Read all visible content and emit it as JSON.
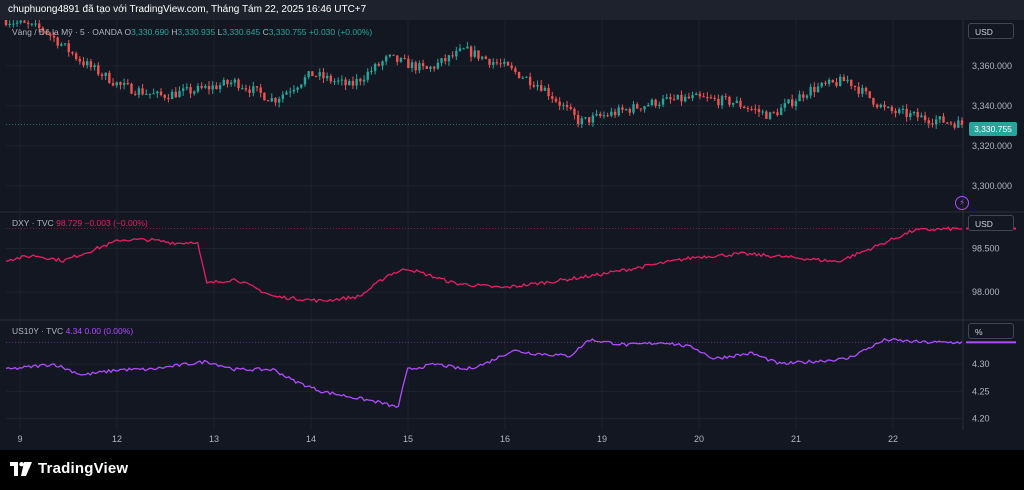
{
  "header": {
    "text": "chuphuong4891 đã tạo với TradingView.com, Tháng Tám 22, 2025 16:46 UTC+7"
  },
  "panes": {
    "gold": {
      "symbol": "Vàng / Đô la Mỹ · 5 · OANDA",
      "o_key": "O",
      "o_val": "3,330.690",
      "h_key": "H",
      "h_val": "3,330.935",
      "l_key": "L",
      "l_val": "3,330.645",
      "c_key": "C",
      "c_val": "3,330.755",
      "change": "+0.030 (+0.00%)",
      "unit": "USD",
      "last_price": "3,330.755"
    },
    "dxy": {
      "symbol": "DXY · TVC",
      "value": "98.729",
      "change": "−0.003 (−0.00%)",
      "unit": "USD"
    },
    "us10y": {
      "symbol": "US10Y · TVC",
      "value": "4.34",
      "change": "0.00 (0.00%)",
      "unit": "%"
    }
  },
  "footer": {
    "brand": "TradingView"
  },
  "colors": {
    "background": "#131722",
    "grid": "#1e222d",
    "up": "#26a69a",
    "down": "#ef5350",
    "dxy_line": "#e91e63",
    "us10y_line": "#b04bff",
    "text": "#b2b5be"
  },
  "icons": {
    "brand_logo": "tradingview-logo-icon",
    "alert": "lightning-icon"
  },
  "chart_data": [
    {
      "type": "candlestick",
      "title": "Vàng / Đô la Mỹ · 5 · OANDA",
      "x_ticks": [
        "9",
        "12",
        "13",
        "14",
        "15",
        "16",
        "19",
        "20",
        "21",
        "22"
      ],
      "y_ticks": [
        "3,300.000",
        "3,320.000",
        "3,340.000",
        "3,360.000"
      ],
      "ylim": [
        3290,
        3380
      ],
      "x": [
        0,
        4,
        8,
        12,
        16,
        20,
        24,
        28,
        32,
        36,
        40,
        44,
        48,
        52,
        56,
        60,
        64,
        68,
        72,
        76,
        80,
        84,
        88,
        92,
        96,
        100
      ],
      "close": [
        3383,
        3378,
        3362,
        3350,
        3345,
        3348,
        3352,
        3343,
        3356,
        3350,
        3364,
        3358,
        3368,
        3360,
        3350,
        3332,
        3337,
        3342,
        3344,
        3342,
        3335,
        3348,
        3353,
        3338,
        3334,
        3331
      ],
      "last": 3330.755,
      "grid": true
    },
    {
      "type": "line",
      "title": "DXY · TVC",
      "series": [
        {
          "name": "DXY · TVC",
          "values": [
            98.37,
            98.42,
            98.36,
            98.48,
            98.6,
            98.6,
            98.56,
            98.58,
            98.1,
            98.15,
            97.95,
            97.9,
            97.95,
            98.2,
            98.27,
            98.1,
            98.05,
            98.12,
            98.2,
            98.3,
            98.4,
            98.44,
            98.4,
            98.35,
            98.48,
            98.71,
            98.73
          ]
        }
      ],
      "x": [
        0,
        3,
        6,
        9,
        12,
        15,
        18,
        20,
        21,
        24,
        28,
        33,
        37,
        40,
        42,
        47,
        52,
        57,
        62,
        67,
        72,
        77,
        82,
        87,
        90,
        95,
        100
      ],
      "y_ticks": [
        "98.000",
        "98.500"
      ],
      "ylim": [
        97.75,
        98.85
      ],
      "last": 98.729,
      "grid": true
    },
    {
      "type": "line",
      "title": "US10Y · TVC",
      "series": [
        {
          "name": "US10Y · TVC",
          "values": [
            4.29,
            4.3,
            4.28,
            4.29,
            4.29,
            4.305,
            4.29,
            4.29,
            4.27,
            4.25,
            4.24,
            4.23,
            4.22,
            4.29,
            4.3,
            4.29,
            4.3,
            4.325,
            4.32,
            4.315,
            4.345,
            4.335,
            4.34,
            4.33,
            4.31,
            4.32,
            4.3,
            4.31,
            4.345,
            4.34,
            4.34
          ]
        }
      ],
      "x": [
        0,
        5,
        8,
        12,
        15,
        21,
        24,
        28,
        30,
        33,
        36,
        39,
        41,
        42,
        45,
        48,
        50,
        53,
        55,
        59,
        61,
        65,
        69,
        72,
        74,
        78,
        81,
        88,
        92,
        96,
        100
      ],
      "y_ticks": [
        "4.20",
        "4.25",
        "4.30"
      ],
      "ylim": [
        4.19,
        4.37
      ],
      "last": 4.34,
      "grid": true
    }
  ]
}
